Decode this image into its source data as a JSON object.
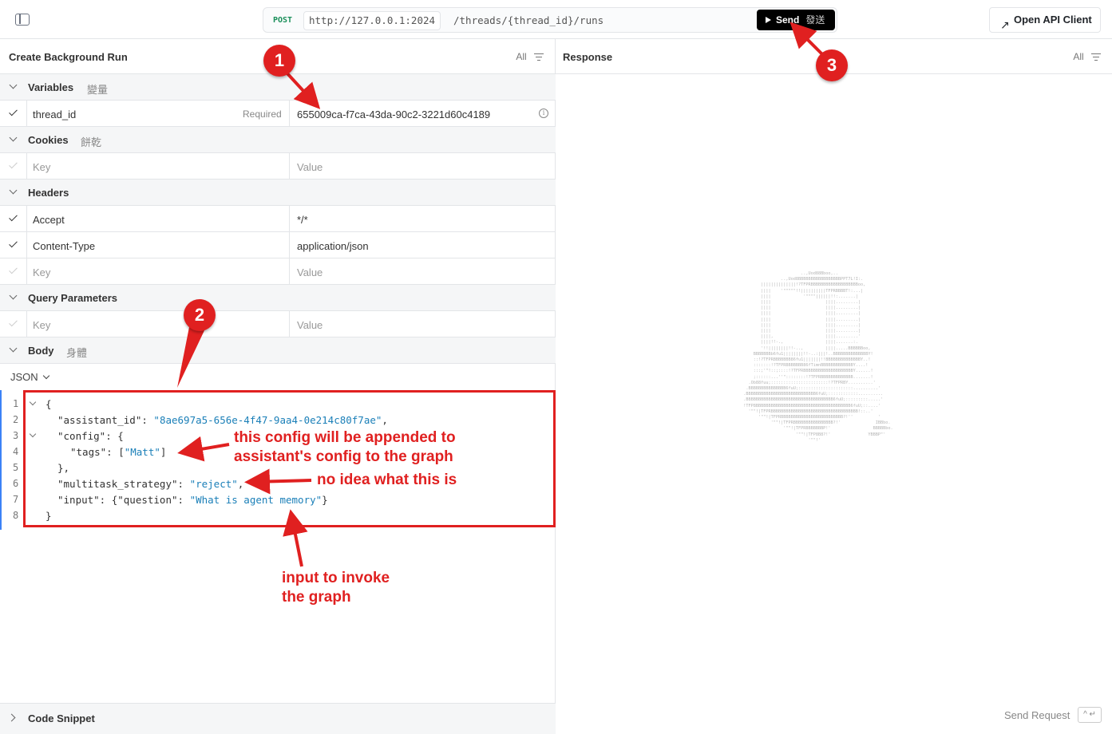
{
  "toolbar": {
    "method": "POST",
    "base_url": "http://127.0.0.1:2024",
    "path": "/threads/{thread_id}/runs",
    "send_label": "Send",
    "send_sub": "發送",
    "open_api_label": "Open API Client"
  },
  "left": {
    "title": "Create Background Run",
    "filter": "All",
    "sections": {
      "variables": {
        "name": "Variables",
        "zh": "變量"
      },
      "cookies": {
        "name": "Cookies",
        "zh": "餅乾"
      },
      "headers": {
        "name": "Headers"
      },
      "query": {
        "name": "Query Parameters"
      },
      "body": {
        "name": "Body",
        "zh": "身體"
      }
    },
    "variables_rows": [
      {
        "key": "thread_id",
        "required": "Required",
        "value": "655009ca-f7ca-43da-90c2-3221d60c4189"
      }
    ],
    "placeholders": {
      "key": "Key",
      "value": "Value"
    },
    "headers_rows": [
      {
        "key": "Accept",
        "value": "*/*"
      },
      {
        "key": "Content-Type",
        "value": "application/json"
      }
    ],
    "body_format": "JSON",
    "code_lines": {
      "l1": "{",
      "l2_key": "\"assistant_id\": ",
      "l2_val": "\"8ae697a5-656e-4f47-9aa4-0e214c80f7ae\"",
      "l3": "\"config\": {",
      "l4_key": "\"tags\": [",
      "l4_val": "\"Matt\"",
      "l4_end": "]",
      "l5": "},",
      "l6_key": "\"multitask_strategy\": ",
      "l6_val": "\"reject\"",
      "l7_key": "\"input\": {\"question\": ",
      "l7_val": "\"What is agent memory\"",
      "l7_end": "}",
      "l8": "}"
    },
    "line_numbers": [
      "1",
      "2",
      "3",
      "4",
      "5",
      "6",
      "7",
      "8"
    ],
    "code_snippet": "Code Snippet"
  },
  "right": {
    "title": "Response",
    "filter": "All",
    "send_request": "Send Request",
    "shortcut": "^ ↵"
  },
  "annotations": {
    "badge1": "1",
    "badge2": "2",
    "badge3": "3",
    "note_config_1": "this config will be appended to",
    "note_config_2": "assistant's config to the graph",
    "note_strategy": "no idea what this is",
    "note_input_1": "input to invoke",
    "note_input_2": "the graph",
    "color": "#e02020"
  }
}
